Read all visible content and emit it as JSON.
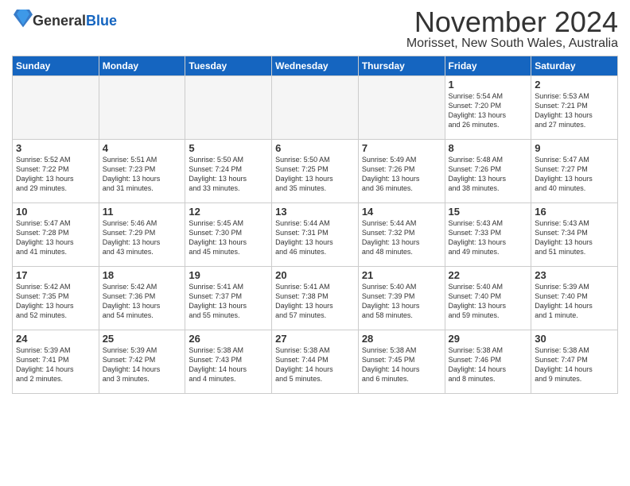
{
  "header": {
    "logo_general": "General",
    "logo_blue": "Blue",
    "month_title": "November 2024",
    "location": "Morisset, New South Wales, Australia"
  },
  "days_of_week": [
    "Sunday",
    "Monday",
    "Tuesday",
    "Wednesday",
    "Thursday",
    "Friday",
    "Saturday"
  ],
  "weeks": [
    [
      {
        "day": "",
        "details": "",
        "empty": true
      },
      {
        "day": "",
        "details": "",
        "empty": true
      },
      {
        "day": "",
        "details": "",
        "empty": true
      },
      {
        "day": "",
        "details": "",
        "empty": true
      },
      {
        "day": "",
        "details": "",
        "empty": true
      },
      {
        "day": "1",
        "details": "Sunrise: 5:54 AM\nSunset: 7:20 PM\nDaylight: 13 hours\nand 26 minutes.",
        "empty": false
      },
      {
        "day": "2",
        "details": "Sunrise: 5:53 AM\nSunset: 7:21 PM\nDaylight: 13 hours\nand 27 minutes.",
        "empty": false
      }
    ],
    [
      {
        "day": "3",
        "details": "Sunrise: 5:52 AM\nSunset: 7:22 PM\nDaylight: 13 hours\nand 29 minutes.",
        "empty": false
      },
      {
        "day": "4",
        "details": "Sunrise: 5:51 AM\nSunset: 7:23 PM\nDaylight: 13 hours\nand 31 minutes.",
        "empty": false
      },
      {
        "day": "5",
        "details": "Sunrise: 5:50 AM\nSunset: 7:24 PM\nDaylight: 13 hours\nand 33 minutes.",
        "empty": false
      },
      {
        "day": "6",
        "details": "Sunrise: 5:50 AM\nSunset: 7:25 PM\nDaylight: 13 hours\nand 35 minutes.",
        "empty": false
      },
      {
        "day": "7",
        "details": "Sunrise: 5:49 AM\nSunset: 7:26 PM\nDaylight: 13 hours\nand 36 minutes.",
        "empty": false
      },
      {
        "day": "8",
        "details": "Sunrise: 5:48 AM\nSunset: 7:26 PM\nDaylight: 13 hours\nand 38 minutes.",
        "empty": false
      },
      {
        "day": "9",
        "details": "Sunrise: 5:47 AM\nSunset: 7:27 PM\nDaylight: 13 hours\nand 40 minutes.",
        "empty": false
      }
    ],
    [
      {
        "day": "10",
        "details": "Sunrise: 5:47 AM\nSunset: 7:28 PM\nDaylight: 13 hours\nand 41 minutes.",
        "empty": false
      },
      {
        "day": "11",
        "details": "Sunrise: 5:46 AM\nSunset: 7:29 PM\nDaylight: 13 hours\nand 43 minutes.",
        "empty": false
      },
      {
        "day": "12",
        "details": "Sunrise: 5:45 AM\nSunset: 7:30 PM\nDaylight: 13 hours\nand 45 minutes.",
        "empty": false
      },
      {
        "day": "13",
        "details": "Sunrise: 5:44 AM\nSunset: 7:31 PM\nDaylight: 13 hours\nand 46 minutes.",
        "empty": false
      },
      {
        "day": "14",
        "details": "Sunrise: 5:44 AM\nSunset: 7:32 PM\nDaylight: 13 hours\nand 48 minutes.",
        "empty": false
      },
      {
        "day": "15",
        "details": "Sunrise: 5:43 AM\nSunset: 7:33 PM\nDaylight: 13 hours\nand 49 minutes.",
        "empty": false
      },
      {
        "day": "16",
        "details": "Sunrise: 5:43 AM\nSunset: 7:34 PM\nDaylight: 13 hours\nand 51 minutes.",
        "empty": false
      }
    ],
    [
      {
        "day": "17",
        "details": "Sunrise: 5:42 AM\nSunset: 7:35 PM\nDaylight: 13 hours\nand 52 minutes.",
        "empty": false
      },
      {
        "day": "18",
        "details": "Sunrise: 5:42 AM\nSunset: 7:36 PM\nDaylight: 13 hours\nand 54 minutes.",
        "empty": false
      },
      {
        "day": "19",
        "details": "Sunrise: 5:41 AM\nSunset: 7:37 PM\nDaylight: 13 hours\nand 55 minutes.",
        "empty": false
      },
      {
        "day": "20",
        "details": "Sunrise: 5:41 AM\nSunset: 7:38 PM\nDaylight: 13 hours\nand 57 minutes.",
        "empty": false
      },
      {
        "day": "21",
        "details": "Sunrise: 5:40 AM\nSunset: 7:39 PM\nDaylight: 13 hours\nand 58 minutes.",
        "empty": false
      },
      {
        "day": "22",
        "details": "Sunrise: 5:40 AM\nSunset: 7:40 PM\nDaylight: 13 hours\nand 59 minutes.",
        "empty": false
      },
      {
        "day": "23",
        "details": "Sunrise: 5:39 AM\nSunset: 7:40 PM\nDaylight: 14 hours\nand 1 minute.",
        "empty": false
      }
    ],
    [
      {
        "day": "24",
        "details": "Sunrise: 5:39 AM\nSunset: 7:41 PM\nDaylight: 14 hours\nand 2 minutes.",
        "empty": false
      },
      {
        "day": "25",
        "details": "Sunrise: 5:39 AM\nSunset: 7:42 PM\nDaylight: 14 hours\nand 3 minutes.",
        "empty": false
      },
      {
        "day": "26",
        "details": "Sunrise: 5:38 AM\nSunset: 7:43 PM\nDaylight: 14 hours\nand 4 minutes.",
        "empty": false
      },
      {
        "day": "27",
        "details": "Sunrise: 5:38 AM\nSunset: 7:44 PM\nDaylight: 14 hours\nand 5 minutes.",
        "empty": false
      },
      {
        "day": "28",
        "details": "Sunrise: 5:38 AM\nSunset: 7:45 PM\nDaylight: 14 hours\nand 6 minutes.",
        "empty": false
      },
      {
        "day": "29",
        "details": "Sunrise: 5:38 AM\nSunset: 7:46 PM\nDaylight: 14 hours\nand 8 minutes.",
        "empty": false
      },
      {
        "day": "30",
        "details": "Sunrise: 5:38 AM\nSunset: 7:47 PM\nDaylight: 14 hours\nand 9 minutes.",
        "empty": false
      }
    ]
  ]
}
